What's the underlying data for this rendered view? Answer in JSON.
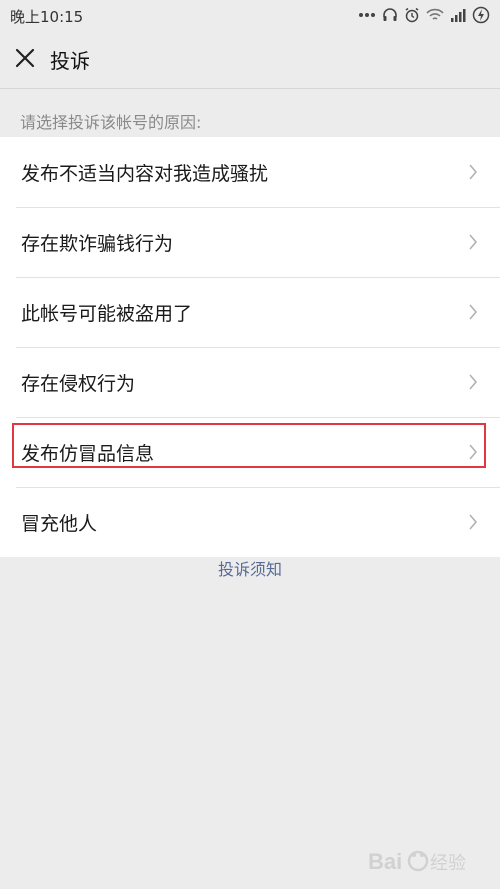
{
  "status_bar": {
    "time": "晚上10:15"
  },
  "title_bar": {
    "title": "投诉"
  },
  "section": {
    "hint": "请选择投诉该帐号的原因:"
  },
  "reasons": [
    {
      "label": "发布不适当内容对我造成骚扰"
    },
    {
      "label": "存在欺诈骗钱行为"
    },
    {
      "label": "此帐号可能被盗用了"
    },
    {
      "label": "存在侵权行为"
    },
    {
      "label": "发布仿冒品信息",
      "highlighted": true
    },
    {
      "label": "冒充他人"
    }
  ],
  "footer": {
    "notice_link": "投诉须知"
  },
  "colors": {
    "background": "#ececec",
    "list_background": "#ffffff",
    "link": "#576b95",
    "highlight_border": "#e0383e",
    "hint_text": "#8a8a8a"
  },
  "icons": {
    "close": "close-icon",
    "chevron": "chevron-right-icon",
    "headphones": "headphones-icon",
    "alarm": "alarm-icon",
    "wifi": "wifi-icon",
    "signal": "signal-icon",
    "battery": "battery-charging-icon"
  }
}
